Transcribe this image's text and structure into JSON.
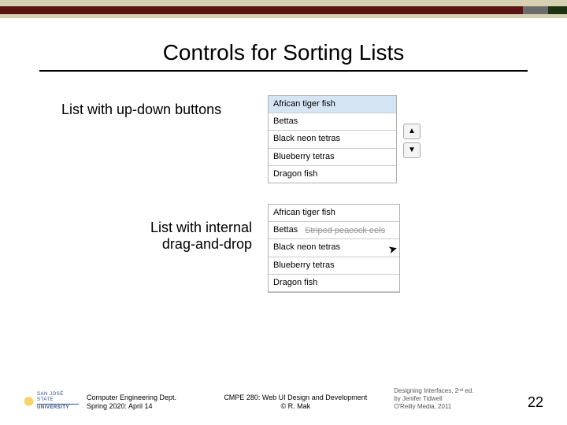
{
  "title": "Controls for Sorting Lists",
  "caption1": "List with up-down buttons",
  "caption2_line1": "List with internal",
  "caption2_line2": "drag-and-drop",
  "list1": {
    "i0": "African tiger fish",
    "i1": "Bettas",
    "i2": "Black neon tetras",
    "i3": "Blueberry tetras",
    "i4": "Dragon fish"
  },
  "list2": {
    "i0": "African tiger fish",
    "i1": "Bettas",
    "i2": "Black neon tetras",
    "i3": "Blueberry tetras",
    "i4": "Dragon fish",
    "drag_item": "Striped peacock eels"
  },
  "arrows": {
    "up": "▲",
    "down": "▼"
  },
  "footer": {
    "sjsu_l1": "SAN JOSÉ STATE",
    "sjsu_l2": "UNIVERSITY",
    "dept_l1": "Computer Engineering Dept.",
    "dept_l2": "Spring 2020: April 14",
    "course_l1": "CMPE 280: Web UI Design and Development",
    "course_l2": "© R. Mak",
    "ref_l1": "Designing Interfaces, 2ⁿᵈ ed.",
    "ref_l2": "by Jenifer Tidwell",
    "ref_l3": "O'Reilly Media, 2011",
    "page": "22"
  }
}
